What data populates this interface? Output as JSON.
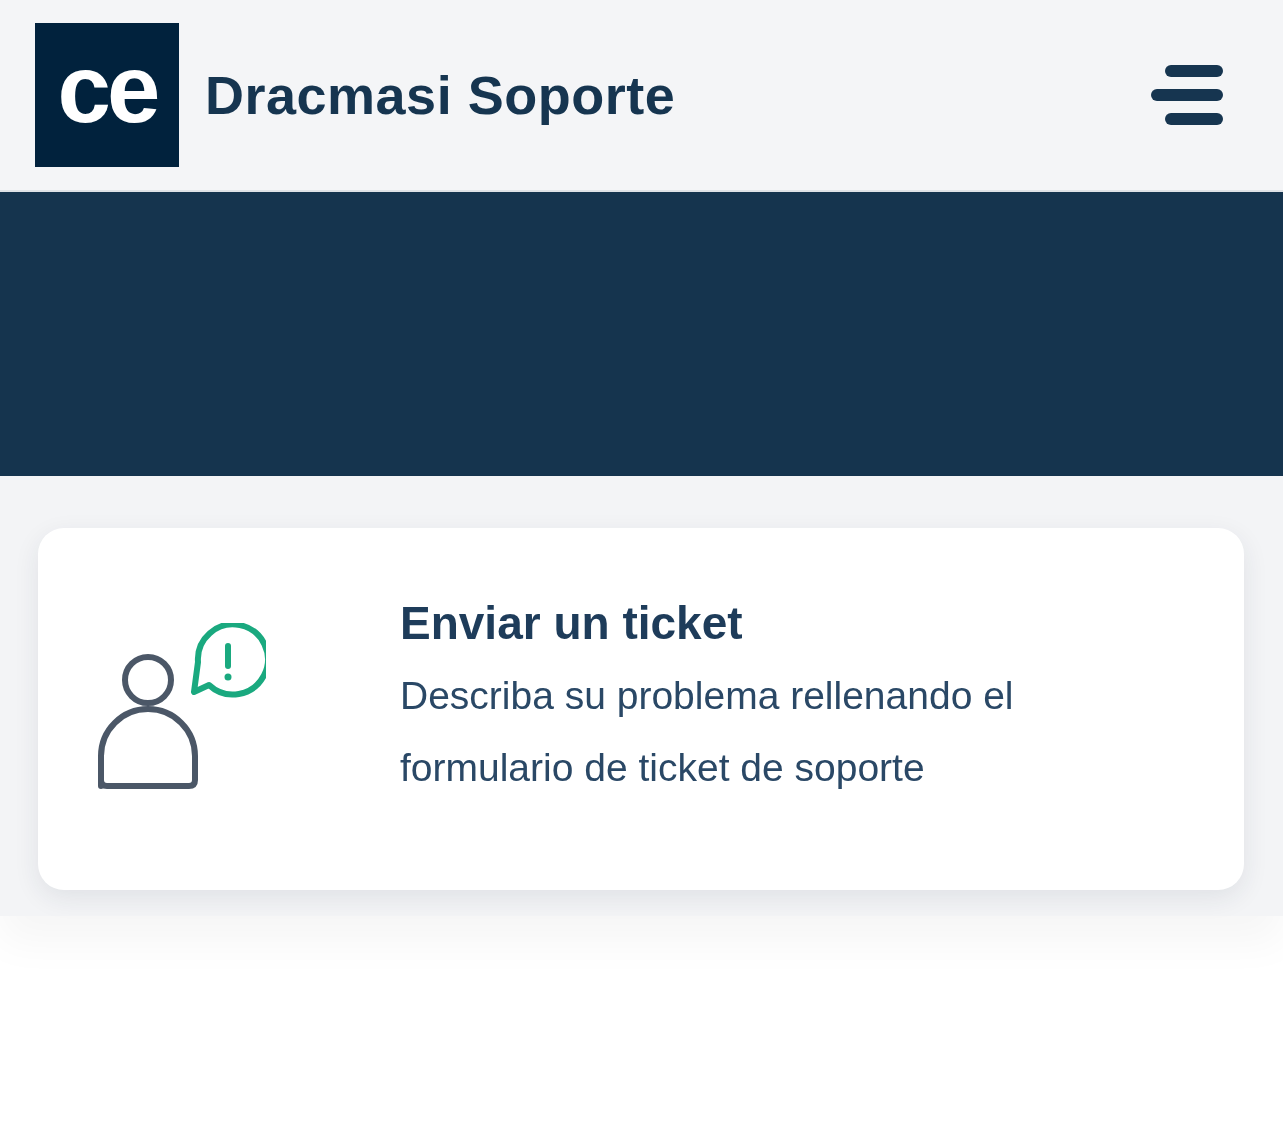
{
  "header": {
    "logo": "ce",
    "title": "Dracmasi Soporte"
  },
  "cards": [
    {
      "kind": "ticket",
      "title": "Enviar un ticket",
      "description": "Describa su problema rellenando el formulario de ticket de soporte"
    }
  ]
}
